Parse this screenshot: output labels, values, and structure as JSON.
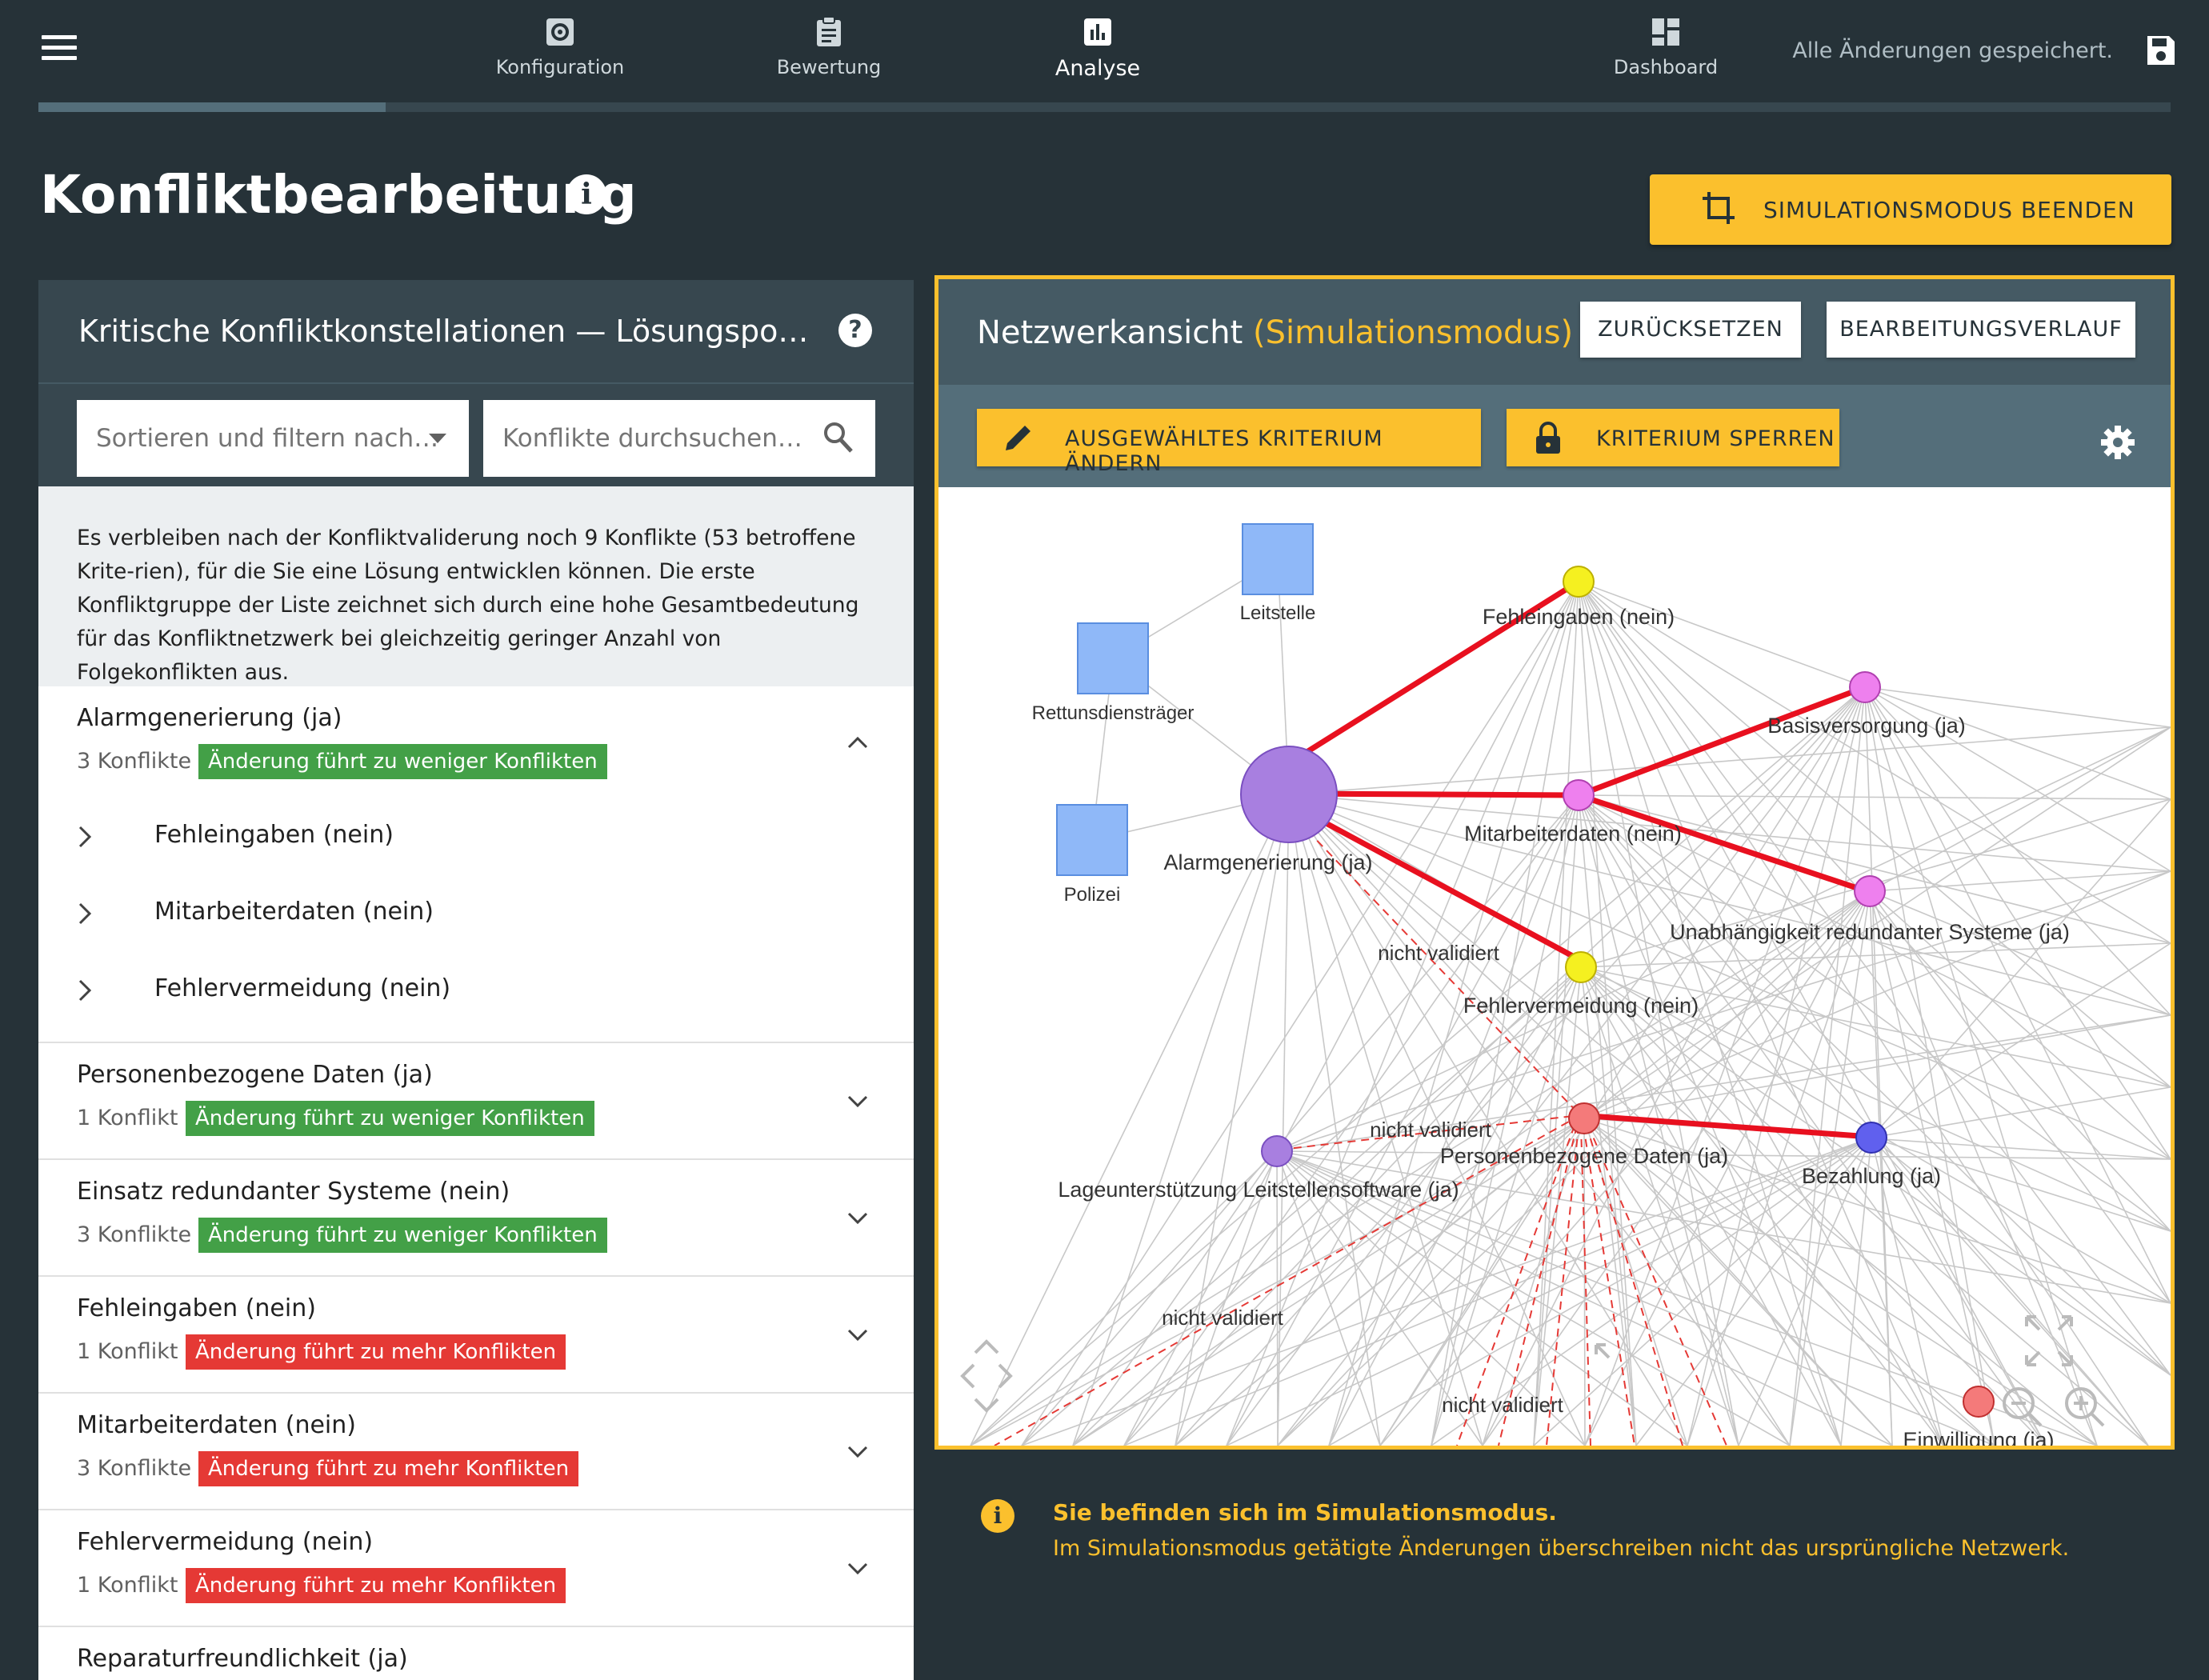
{
  "nav": {
    "tabs": [
      {
        "label": "Konfiguration",
        "icon": "gear-icon"
      },
      {
        "label": "Bewertung",
        "icon": "clipboard-icon"
      },
      {
        "label": "Analyse",
        "icon": "bar-chart-icon"
      },
      {
        "label": "Dashboard",
        "icon": "dashboard-icon"
      }
    ],
    "active_tab": "Analyse",
    "saved_status": "Alle Änderungen gespeichert.",
    "progress_fraction": 0.163
  },
  "page": {
    "title": "Konfliktbearbeitung",
    "sim_button": "SIMULATIONSMODUS BEENDEN"
  },
  "left": {
    "title": "Kritische Konfliktkonstellationen — Lösungspo…",
    "sort_filter": "Sortieren und filtern nach…",
    "search_placeholder": "Konflikte durchsuchen…",
    "info_text": "Es verbleiben nach der Konfliktvaliderung noch 9 Konflikte (53 betroffene Krite-rien), für die Sie eine Lösung entwicklen können. Die erste Konfliktgruppe der Liste zeichnet sich durch eine hohe Gesamtbedeutung für das Konfliktnetzwerk bei gleichzeitig geringer Anzahl von Folgekonflikten aus.",
    "groups": [
      {
        "title": "Alarmgenerierung (ja)",
        "count": "3 Konflikte",
        "badge": "Änderung führt zu weniger Konflikten",
        "badge_type": "green",
        "expanded": true,
        "children": [
          "Fehleingaben (nein)",
          "Mitarbeiterdaten (nein)",
          "Fehlervermeidung (nein)"
        ]
      },
      {
        "title": "Personenbezogene Daten (ja)",
        "count": "1 Konflikt",
        "badge": "Änderung führt zu weniger Konflikten",
        "badge_type": "green"
      },
      {
        "title": "Einsatz redundanter Systeme (nein)",
        "count": "3 Konflikte",
        "badge": "Änderung führt zu weniger Konflikten",
        "badge_type": "green"
      },
      {
        "title": "Fehleingaben (nein)",
        "count": "1 Konflikt",
        "badge": "Änderung führt zu mehr Konflikten",
        "badge_type": "red"
      },
      {
        "title": "Mitarbeiterdaten (nein)",
        "count": "3 Konflikte",
        "badge": "Änderung führt zu mehr Konflikten",
        "badge_type": "red"
      },
      {
        "title": "Fehlervermeidung (nein)",
        "count": "1 Konflikt",
        "badge": "Änderung führt zu mehr Konflikten",
        "badge_type": "red"
      },
      {
        "title": "Reparaturfreundlichkeit (ja)"
      }
    ]
  },
  "right": {
    "title": "Netzwerkansicht",
    "title_mode": "(Simulationsmodus)",
    "reset_button": "ZURÜCKSETZEN",
    "history_button": "BEARBEITUNGSVERLAUF",
    "change_button": "AUSGEWÄHLTES KRITERIUM ÄNDERN",
    "lock_button": "KRITERIUM SPERREN",
    "graph": {
      "nodes": [
        {
          "id": "leitstelle",
          "label": "Leitstelle",
          "shape": "square",
          "color": "#8fb8f8"
        },
        {
          "id": "rettungsdienst",
          "label": "Rettunsdiensträger",
          "shape": "square",
          "color": "#8fb8f8"
        },
        {
          "id": "polizei",
          "label": "Polizei",
          "shape": "square",
          "color": "#8fb8f8"
        },
        {
          "id": "alarm",
          "label": "Alarmgenerierung (ja)",
          "shape": "circle",
          "color": "#a87fe0"
        },
        {
          "id": "fehleingaben",
          "label": "Fehleingaben (nein)",
          "shape": "circle",
          "color": "#f5f020"
        },
        {
          "id": "basis",
          "label": "Basisversorgung (ja)",
          "shape": "circle",
          "color": "#ee80ee"
        },
        {
          "id": "mitarbeiter",
          "label": "Mitarbeiterdaten (nein)",
          "shape": "circle",
          "color": "#ee80ee"
        },
        {
          "id": "unabh",
          "label": "Unabhängigkeit redundanter Systeme (ja)",
          "shape": "circle",
          "color": "#ee80ee"
        },
        {
          "id": "fehlerverm",
          "label": "Fehlervermeidung (nein)",
          "shape": "circle",
          "color": "#f5f020"
        },
        {
          "id": "personen",
          "label": "Personenbezogene Daten (ja)",
          "shape": "circle",
          "color": "#f47a7a"
        },
        {
          "id": "bezahlung",
          "label": "Bezahlung (ja)",
          "shape": "circle",
          "color": "#6060ee"
        },
        {
          "id": "lage",
          "label": "Lageunterstützung Leitstellensoftware (ja)",
          "shape": "circle",
          "color": "#a87fe0"
        },
        {
          "id": "einwilligung",
          "label": "Einwilligung (ja)",
          "shape": "circle",
          "color": "#f47a7a"
        }
      ],
      "edge_labels": [
        "nicht validiert",
        "nicht validiert",
        "nicht validiert",
        "nicht validiert"
      ]
    }
  },
  "notice": {
    "title": "Sie befinden sich im Simulationsmodus.",
    "text": "Im Simulationsmodus getätigte Änderungen überschreiben nicht das ursprüngliche Netzwerk."
  }
}
